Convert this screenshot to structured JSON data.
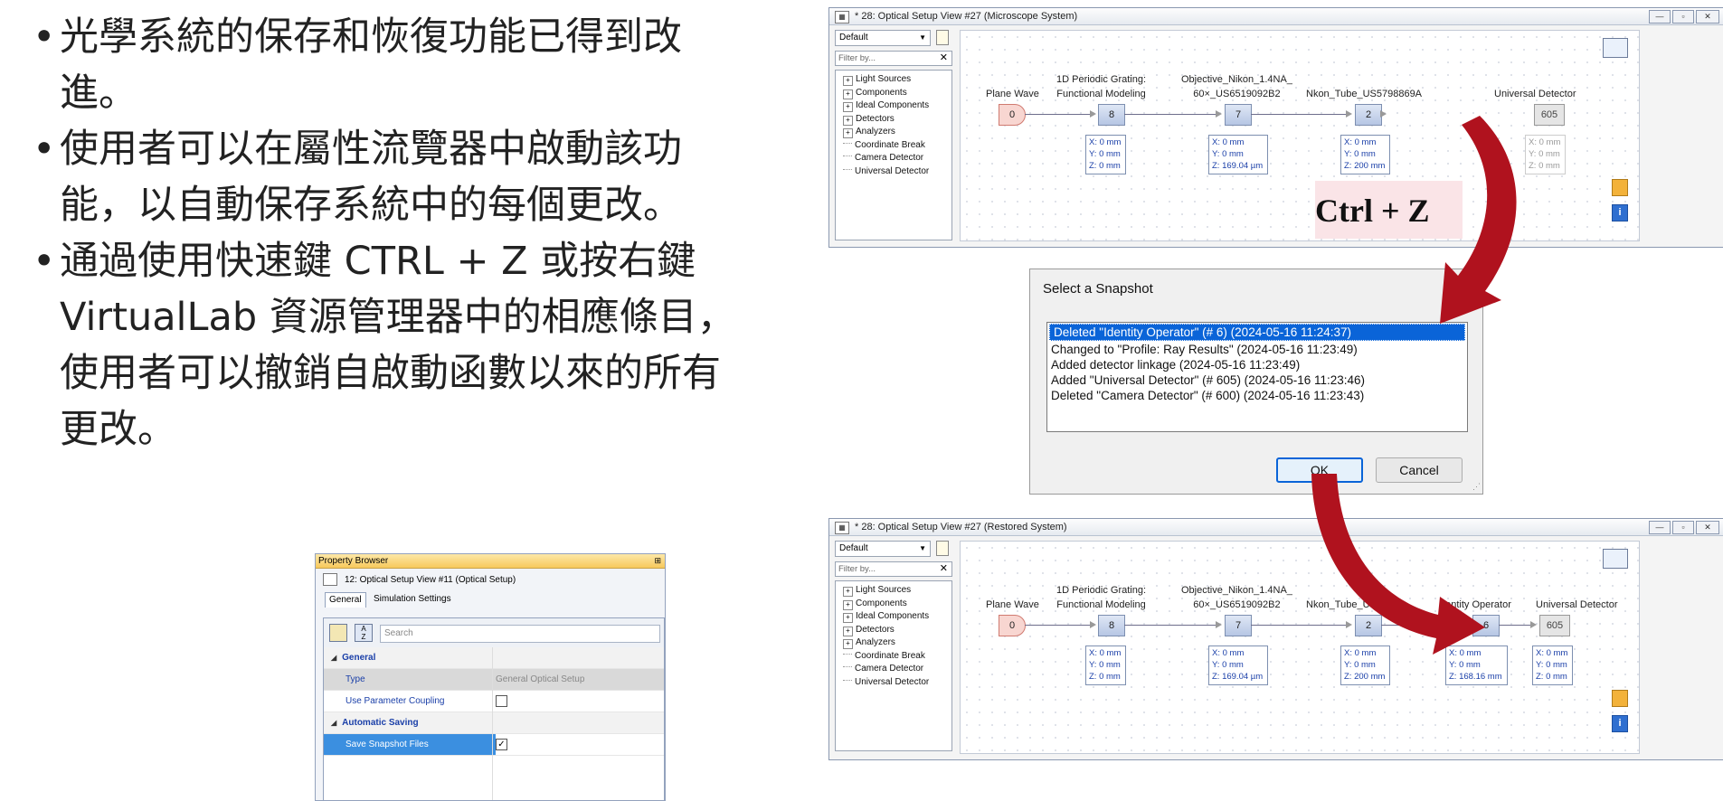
{
  "bullets": [
    {
      "line1": "光學系統的保存和恢復功能已得到改",
      "line2": "進。"
    },
    {
      "line1": "使用者可以在屬性流覽器中啟動該功",
      "line2": "能，以自動保存系統中的每個更改。"
    },
    {
      "line1": "通過使用快速鍵 CTRL + Z 或按右鍵",
      "line2": "VirtualLab 資源管理器中的相應條目，",
      "line3": "使用者可以撤銷自啟動函數以來的所有",
      "line4": "更改。"
    }
  ],
  "window_top": {
    "title": "* 28: Optical Setup View #27 (Microscope System)",
    "select": "Default",
    "filter_placeholder": "Filter by...",
    "tree": [
      "Light Sources",
      "Components",
      "Ideal Components",
      "Detectors",
      "Analyzers",
      "Coordinate Break",
      "Camera Detector",
      "Universal Detector"
    ],
    "labels": {
      "plane_wave": "Plane Wave",
      "grating_1": "1D Periodic Grating:",
      "grating_2": "Functional Modeling",
      "objective_1": "Objective_Nikon_1.4NA_",
      "objective_2": "60×_US6519092B2",
      "tube": "Nkon_Tube_US5798869A",
      "detector": "Universal Detector"
    },
    "nodes": {
      "src": "0",
      "n1": "8",
      "n2": "7",
      "n3": "2",
      "n4": "605"
    },
    "pos": {
      "p1": [
        "X: 0 mm",
        "Y: 0 mm",
        "Z: 0 mm"
      ],
      "p2": [
        "X: 0 mm",
        "Y: 0 mm",
        "Z: 169.04 µm"
      ],
      "p3": [
        "X: 0 mm",
        "Y: 0 mm",
        "Z: 200 mm"
      ],
      "p4": [
        "X: 0 mm",
        "Y: 0 mm",
        "Z: 0 mm"
      ]
    }
  },
  "shortcut": "Ctrl + Z",
  "dialog": {
    "title": "Select a Snapshot",
    "items": [
      "Deleted \"Identity Operator\" (# 6) (2024-05-16 11:24:37)",
      "Changed to \"Profile: Ray Results\" (2024-05-16 11:23:49)",
      "Added detector linkage (2024-05-16 11:23:49)",
      "Added \"Universal Detector\" (# 605) (2024-05-16 11:23:46)",
      "Deleted \"Camera Detector\" (# 600) (2024-05-16 11:23:43)"
    ],
    "ok": "OK",
    "cancel": "Cancel"
  },
  "window_bottom": {
    "title": "* 28: Optical Setup View #27 (Restored System)",
    "select": "Default",
    "filter_placeholder": "Filter by...",
    "tree": [
      "Light Sources",
      "Components",
      "Ideal Components",
      "Detectors",
      "Analyzers",
      "Coordinate Break",
      "Camera Detector",
      "Universal Detector"
    ],
    "labels": {
      "plane_wave": "Plane Wave",
      "grating_1": "1D Periodic Grating:",
      "grating_2": "Functional Modeling",
      "objective_1": "Objective_Nikon_1.4NA_",
      "objective_2": "60×_US6519092B2",
      "tube": "Nkon_Tube_Us",
      "identity": "dentity Operator",
      "detector": "Universal Detector"
    },
    "nodes": {
      "src": "0",
      "n1": "8",
      "n2": "7",
      "n3": "2",
      "n4": "6",
      "n5": "605"
    },
    "pos": {
      "p1": [
        "X: 0 mm",
        "Y: 0 mm",
        "Z: 0 mm"
      ],
      "p2": [
        "X: 0 mm",
        "Y: 0 mm",
        "Z: 169.04 µm"
      ],
      "p3": [
        "X: 0 mm",
        "Y: 0 mm",
        "Z: 200 mm"
      ],
      "p4": [
        "X: 0 mm",
        "Y: 0 mm",
        "Z: 168.16 mm"
      ],
      "p5": [
        "X: 0 mm",
        "Y: 0 mm",
        "Z: 0 mm"
      ]
    }
  },
  "property_browser": {
    "title": "Property Browser",
    "editor": "12: Optical Setup View #11 (Optical Setup)",
    "tabs": [
      "General",
      "Simulation Settings"
    ],
    "search_placeholder": "Search",
    "cat_general": "General",
    "type_key": "Type",
    "type_value": "General Optical Setup",
    "coupling_key": "Use Parameter Coupling",
    "cat_saving": "Automatic Saving",
    "snapshot_key": "Save Snapshot Files"
  },
  "colors": {
    "arrow": "#b0121e",
    "selection": "#0a64d8",
    "shortcut_bg": "#fae4e7"
  }
}
